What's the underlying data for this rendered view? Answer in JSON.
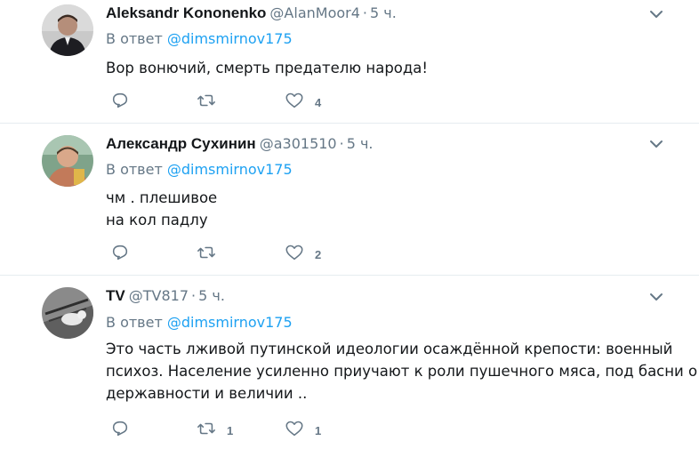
{
  "tweets": [
    {
      "name": "Aleksandr Kononenko",
      "handle": "@AlanMoor4",
      "separator": "·",
      "time": "5 ч.",
      "reply_prefix": "В ответ",
      "reply_to": "@dimsmirnov175",
      "lines": [
        "Вор вонючий, смерть предателю народа!"
      ],
      "retweets": "",
      "likes": "4"
    },
    {
      "name": "Александр Сухинин",
      "handle": "@a301510",
      "separator": "·",
      "time": "5 ч.",
      "reply_prefix": "В ответ",
      "reply_to": "@dimsmirnov175",
      "lines": [
        "чм . плешивое",
        "на кол падлу"
      ],
      "retweets": "",
      "likes": "2"
    },
    {
      "name": "TV",
      "handle": "@TV817",
      "separator": "·",
      "time": "5 ч.",
      "reply_prefix": "В ответ",
      "reply_to": "@dimsmirnov175",
      "lines": [
        "Это часть лживой путинской идеологии осаждённой крепости: военный",
        "психоз. Население усиленно приучают к роли пушечного мяса, под басни о",
        "державности и величии .."
      ],
      "retweets": "1",
      "likes": "1"
    }
  ],
  "icons": {
    "reply": "reply-icon",
    "retweet": "retweet-icon",
    "like": "heart-icon",
    "caret": "chevron-down-icon"
  },
  "colors": {
    "link": "#1da1f2",
    "muted": "#657786",
    "icon": "#657786",
    "divider": "#e6ecf0"
  }
}
